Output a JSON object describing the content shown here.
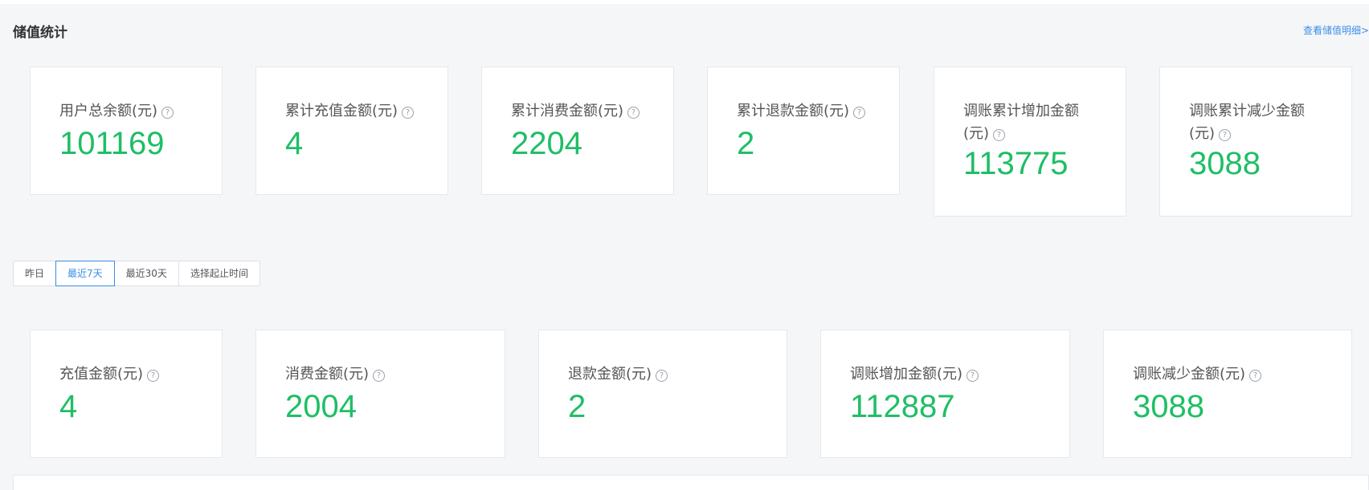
{
  "header": {
    "title": "储值统计",
    "detail_link": "查看储值明细>"
  },
  "summary_cards": [
    {
      "label": "用户总余额(元)",
      "value": "101169"
    },
    {
      "label": "累计充值金额(元)",
      "value": "4"
    },
    {
      "label": "累计消费金额(元)",
      "value": "2204"
    },
    {
      "label": "累计退款金额(元)",
      "value": "2"
    },
    {
      "label": "调账累计增加金额(元)",
      "value": "113775"
    },
    {
      "label": "调账累计减少金额(元)",
      "value": "3088"
    }
  ],
  "help_icon": {
    "glyph": "?",
    "icon": "question-circle-icon"
  },
  "date_filter": {
    "options": [
      "昨日",
      "最近7天",
      "最近30天",
      "选择起止时间"
    ],
    "selected": "最近7天"
  },
  "period_cards": [
    {
      "label": "充值金额(元)",
      "value": "4"
    },
    {
      "label": "消费金额(元)",
      "value": "2004"
    },
    {
      "label": "退款金额(元)",
      "value": "2"
    },
    {
      "label": "调账增加金额(元)",
      "value": "112887"
    },
    {
      "label": "调账减少金额(元)",
      "value": "3088"
    }
  ],
  "colors": {
    "value_green": "#1fbe66",
    "link_blue": "#3a8ee6",
    "background": "#f5f6f8"
  }
}
